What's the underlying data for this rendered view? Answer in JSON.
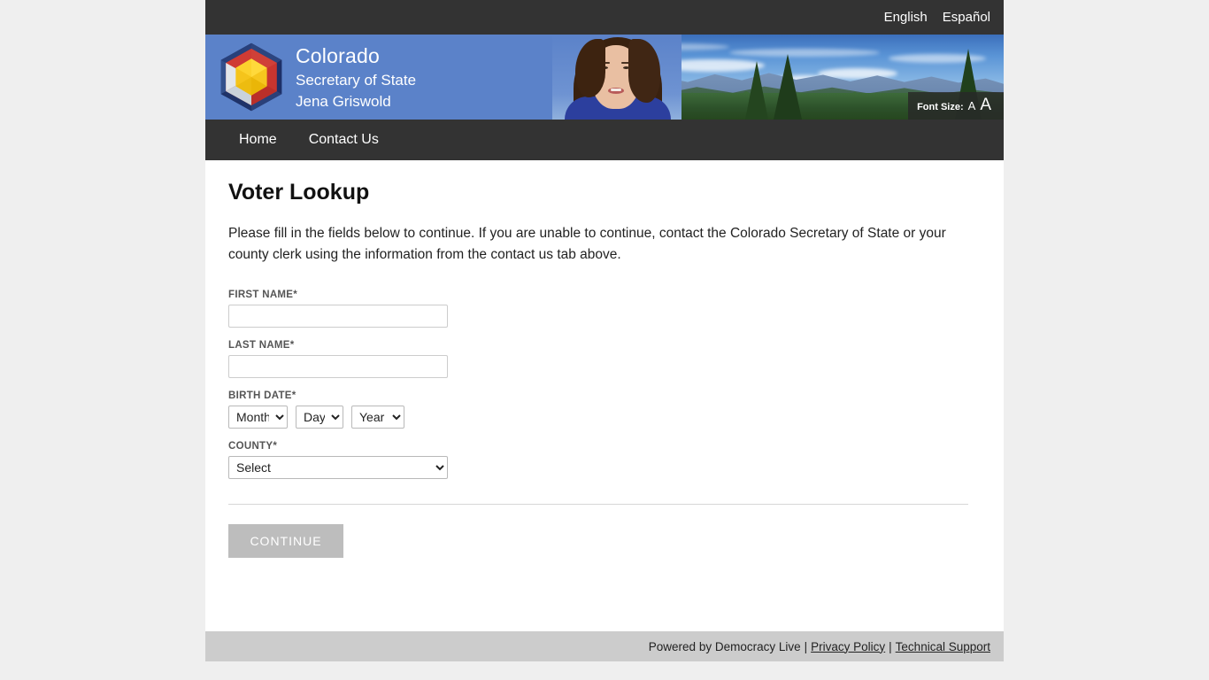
{
  "language_bar": {
    "links": [
      {
        "label": "English",
        "name": "language-link-english"
      },
      {
        "label": "Español",
        "name": "language-link-espanol"
      }
    ]
  },
  "banner": {
    "logo_icon": "colorado-hexagon-logo-icon",
    "brand_line1": "Colorado",
    "brand_line2": "Secretary of State",
    "brand_line3": "Jena Griswold",
    "photo_alt": "jena-griswold-portrait",
    "landscape_alt": "colorado-mountains-landscape",
    "font_size": {
      "label": "Font Size:",
      "small_a": "A",
      "large_a": "A"
    },
    "colors": {
      "banner_blue": "#5b82c9",
      "dark_bar": "#333333"
    }
  },
  "nav": {
    "items": [
      {
        "label": "Home",
        "name": "nav-item-home"
      },
      {
        "label": "Contact Us",
        "name": "nav-item-contact-us"
      }
    ]
  },
  "main": {
    "title": "Voter Lookup",
    "intro": "Please fill in the fields below to continue. If you are unable to continue, contact the Colorado Secretary of State or your county clerk using the information from the contact us tab above.",
    "fields": {
      "first_name": {
        "label": "FIRST NAME*",
        "value": "",
        "placeholder": ""
      },
      "last_name": {
        "label": "LAST NAME*",
        "value": "",
        "placeholder": ""
      },
      "birth_date": {
        "label": "BIRTH DATE*",
        "month": {
          "selected": "Month"
        },
        "day": {
          "selected": "Day"
        },
        "year": {
          "selected": "Year"
        }
      },
      "county": {
        "label": "COUNTY*",
        "selected": "Select"
      }
    },
    "continue_label": "CONTINUE"
  },
  "footer": {
    "powered_by": "Powered by Democracy Live",
    "sep1": "|",
    "privacy_policy": "Privacy Policy",
    "sep2": "|",
    "technical_support": "Technical Support"
  }
}
